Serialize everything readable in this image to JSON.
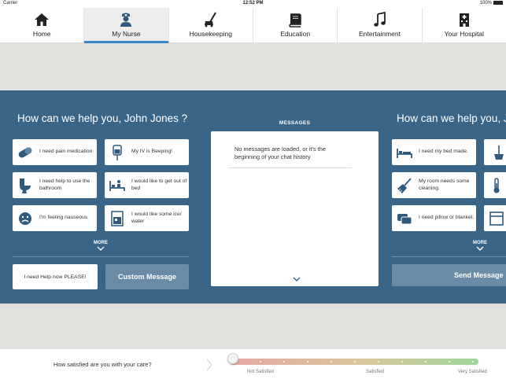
{
  "status": {
    "carrier": "Carrier",
    "time": "12:52 PM",
    "battery": "100%"
  },
  "nav": {
    "tabs": [
      {
        "label": "Home",
        "icon": "home-icon"
      },
      {
        "label": "My Nurse",
        "icon": "nurse-icon",
        "active": true
      },
      {
        "label": "Housekeeping",
        "icon": "vacuum-icon"
      },
      {
        "label": "Education",
        "icon": "book-icon"
      },
      {
        "label": "Entertainment",
        "icon": "music-note-icon"
      },
      {
        "label": "Your Hospital",
        "icon": "hospital-icon"
      }
    ]
  },
  "nurse": {
    "greeting": "How can we help you,  John Jones ?",
    "requests": [
      "I need pain medication",
      "My IV is Beeping!",
      "I need help to use the bathroom",
      "I would like to get out of bed",
      "I'm feeling nauseous",
      "I would like some ice/ water"
    ],
    "more_label": "MORE",
    "help_label": "I need Help now PLEASE!",
    "custom_label": "Custom Message"
  },
  "messages": {
    "title": "MESSAGES",
    "empty_text": "No messages are loaded, or it's the beginning of your chat history"
  },
  "housekeeping": {
    "greeting": "How can we help you,  J",
    "requests": [
      "I need my bed made.",
      "My room needs some cleaning.",
      "I need pillow or blanket."
    ],
    "more_label": "MORE",
    "send_label": "Send Message"
  },
  "satisfaction": {
    "question": "How satisfied are you with your care?",
    "labels": [
      "Not Satisfied",
      "Satisfied",
      "Very Satisfied"
    ],
    "value": 0
  },
  "colors": {
    "panel": "#3b6586",
    "accent": "#3a86c8",
    "icon": "#2f5a7d"
  }
}
